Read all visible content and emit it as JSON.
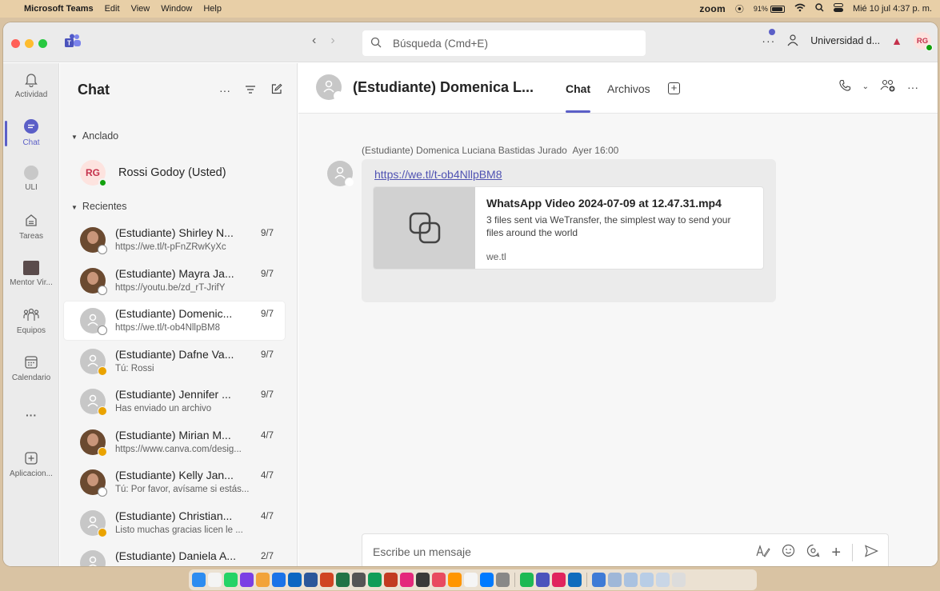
{
  "menubar": {
    "app_name": "Microsoft Teams",
    "items": [
      "Edit",
      "View",
      "Window",
      "Help"
    ],
    "zoom": "zoom",
    "battery": "91%",
    "datetime": "Mié 10 jul 4:37 p. m."
  },
  "titlebar": {
    "search_placeholder": "Búsqueda (Cmd+E)",
    "more": "···",
    "org": "Universidad d...",
    "user_initials": "RG"
  },
  "rail": {
    "items": [
      {
        "label": "Actividad",
        "icon": "bell-icon"
      },
      {
        "label": "Chat",
        "icon": "chat-icon"
      },
      {
        "label": "ULI",
        "icon": "team-badge-icon"
      },
      {
        "label": "Tareas",
        "icon": "assignments-icon"
      },
      {
        "label": "Mentor Vir...",
        "icon": "mentor-thumb"
      },
      {
        "label": "Equipos",
        "icon": "teams-icon"
      },
      {
        "label": "Calendario",
        "icon": "calendar-icon"
      },
      {
        "label": "···",
        "icon": "more-icon"
      },
      {
        "label": "Aplicacion...",
        "icon": "add-apps-icon"
      }
    ]
  },
  "chat_list": {
    "title": "Chat",
    "pinned_label": "Anclado",
    "recent_label": "Recientes",
    "pinned": {
      "initials": "RG",
      "name": "Rossi Godoy (Usted)"
    },
    "recent": [
      {
        "name": "(Estudiante) Shirley N...",
        "date": "9/7",
        "preview": "https://we.tl/t-pFnZRwKyXc",
        "status": "offline",
        "photo": true
      },
      {
        "name": "(Estudiante) Mayra Ja...",
        "date": "9/7",
        "preview": "https://youtu.be/zd_rT-JrifY",
        "status": "offline",
        "photo": true
      },
      {
        "name": "(Estudiante) Domenic...",
        "date": "9/7",
        "preview": "https://we.tl/t-ob4NllpBM8",
        "status": "offline",
        "photo": false,
        "selected": true
      },
      {
        "name": "(Estudiante) Dafne Va...",
        "date": "9/7",
        "preview": "Tú: Rossi",
        "status": "away",
        "photo": false
      },
      {
        "name": "(Estudiante) Jennifer ...",
        "date": "9/7",
        "preview": "Has enviado un archivo",
        "status": "away",
        "photo": false
      },
      {
        "name": "(Estudiante) Mirian M...",
        "date": "4/7",
        "preview": "https://www.canva.com/desig...",
        "status": "away",
        "photo": true
      },
      {
        "name": "(Estudiante) Kelly Jan...",
        "date": "4/7",
        "preview": "Tú: Por favor, avísame si estás...",
        "status": "offline",
        "photo": true
      },
      {
        "name": "(Estudiante) Christian...",
        "date": "4/7",
        "preview": "Listo muchas gracias licen le ...",
        "status": "away",
        "photo": false
      },
      {
        "name": "(Estudiante) Daniela A...",
        "date": "2/7",
        "preview": "",
        "status": "away",
        "photo": false
      }
    ]
  },
  "conversation": {
    "title": "(Estudiante) Domenica L...",
    "tabs": [
      "Chat",
      "Archivos"
    ],
    "active_tab": "Chat",
    "message": {
      "sender": "(Estudiante) Domenica Luciana Bastidas Jurado",
      "time": "Ayer 16:00",
      "link": "https://we.tl/t-ob4NllpBM8",
      "card": {
        "title": "WhatsApp Video 2024-07-09 at 12.47.31.mp4",
        "description": "3 files sent via WeTransfer, the simplest way to send your files around the world",
        "domain": "we.tl"
      }
    },
    "composer_placeholder": "Escribe un mensaje"
  },
  "colors": {
    "accent": "#5b5fc7",
    "away": "#eaa300",
    "available": "#13a10e",
    "menubar": "#e8cfa7"
  }
}
